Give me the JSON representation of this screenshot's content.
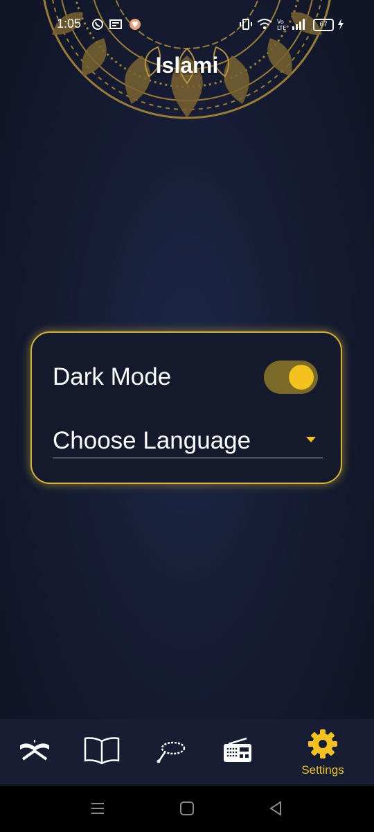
{
  "status_bar": {
    "time": "1:05",
    "battery_level": "67"
  },
  "header": {
    "title": "Islami"
  },
  "settings": {
    "dark_mode_label": "Dark Mode",
    "dark_mode_enabled": true,
    "language_label": "Choose Language"
  },
  "bottom_nav": {
    "items": [
      {
        "icon": "quran-icon",
        "label": ""
      },
      {
        "icon": "book-icon",
        "label": ""
      },
      {
        "icon": "tasbeeh-icon",
        "label": ""
      },
      {
        "icon": "radio-icon",
        "label": ""
      },
      {
        "icon": "gear-icon",
        "label": "Settings"
      }
    ],
    "active_index": 4
  },
  "colors": {
    "accent": "#f4c21f",
    "card_border": "#d7b23a",
    "background": "#151c33",
    "nav_background": "#171e33"
  }
}
